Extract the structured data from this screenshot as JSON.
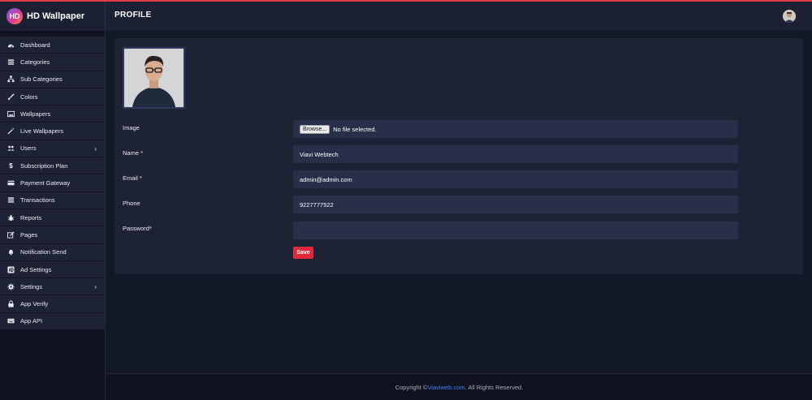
{
  "app": {
    "logo_text": "HD",
    "name": "HD Wallpaper"
  },
  "header": {
    "title": "PROFILE"
  },
  "sidebar": {
    "items": [
      {
        "label": "Dashboard",
        "icon": "dashboard-icon"
      },
      {
        "label": "Categories",
        "icon": "list-icon"
      },
      {
        "label": "Sub Categories",
        "icon": "sitemap-icon"
      },
      {
        "label": "Colors",
        "icon": "brush-icon"
      },
      {
        "label": "Wallpapers",
        "icon": "image-icon"
      },
      {
        "label": "Live Wallpapers",
        "icon": "magic-wand-icon"
      },
      {
        "label": "Users",
        "icon": "users-icon",
        "has_submenu": true
      },
      {
        "label": "Subscription Plan",
        "icon": "dollar-icon"
      },
      {
        "label": "Payment Gateway",
        "icon": "credit-card-icon"
      },
      {
        "label": "Transactions",
        "icon": "list-icon"
      },
      {
        "label": "Reports",
        "icon": "bug-icon"
      },
      {
        "label": "Pages",
        "icon": "edit-icon"
      },
      {
        "label": "Notification Send",
        "icon": "bell-icon"
      },
      {
        "label": "Ad Settings",
        "icon": "ad-icon"
      },
      {
        "label": "Settings",
        "icon": "gear-icon",
        "has_submenu": true
      },
      {
        "label": "App Verify",
        "icon": "lock-icon"
      },
      {
        "label": "App API",
        "icon": "keyboard-icon"
      }
    ]
  },
  "form": {
    "image_label": "Image",
    "browse_label": "Browse...",
    "file_status": "No file selected.",
    "name_label": "Name *",
    "name_value": "Viavi Webtech",
    "email_label": "Email *",
    "email_value": "admin@admin.com",
    "phone_label": "Phone",
    "phone_value": "9227777522",
    "password_label": "Password*",
    "password_value": "",
    "save_label": "Save"
  },
  "footer": {
    "prefix": "Copyright © ",
    "link_text": "Viaviweb.com",
    "suffix": ". All Rights Reserved."
  },
  "colors": {
    "accent": "#e02a3c",
    "sidebar_bg": "#0f1320",
    "card_bg": "#1d2335",
    "field_bg": "#283049",
    "link": "#3b82f6"
  }
}
